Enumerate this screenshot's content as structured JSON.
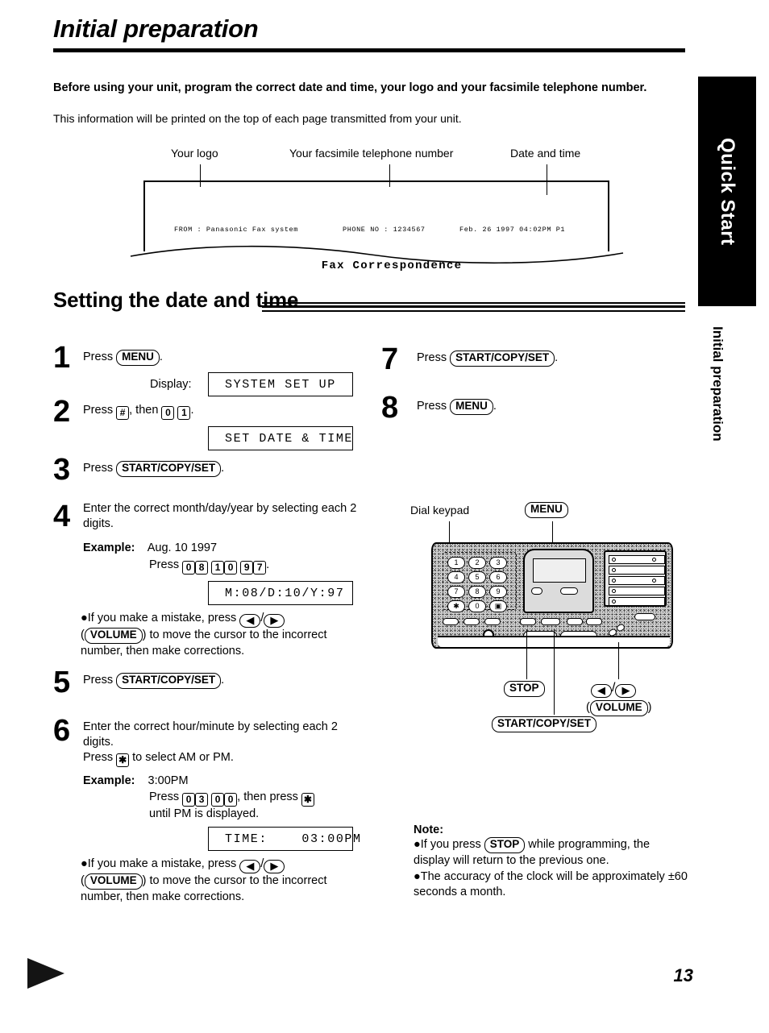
{
  "page": {
    "title": "Initial preparation",
    "number": "13"
  },
  "intro": {
    "bold": "Before using your unit, program the correct date and time, your logo and your facsimile telephone number.",
    "plain": "This information will be printed on the top of each page transmitted from your unit."
  },
  "fax_sample": {
    "callouts": {
      "logo": "Your logo",
      "phone": "Your facsimile telephone number",
      "datetime": "Date and time"
    },
    "header_from": "FROM : Panasonic Fax system",
    "header_phone": "PHONE NO : 1234567",
    "header_date": "Feb. 26 1997 04:02PM P1",
    "body_text": "Fax Correspondence"
  },
  "section": {
    "heading": "Setting the date and time"
  },
  "steps": {
    "s1": {
      "num": "1",
      "press_label": "Press",
      "key": "MENU",
      "period": ".",
      "display_label": "Display:",
      "display_value": "SYSTEM SET UP"
    },
    "s2": {
      "num": "2",
      "press_label": "Press",
      "key_hash": "#",
      "then_label": ", then",
      "key_0": "0",
      "key_1": "1",
      "period": ".",
      "display_value": "SET DATE & TIME"
    },
    "s3": {
      "num": "3",
      "press_label": "Press",
      "key": "START/COPY/SET",
      "period": "."
    },
    "s4": {
      "num": "4",
      "text": "Enter the correct month/day/year by selecting each 2 digits.",
      "example_label": "Example:",
      "example_value": "Aug. 10 1997",
      "press_label": "Press",
      "digits": [
        "0",
        "8",
        "1",
        "0",
        "9",
        "7"
      ],
      "period": ".",
      "display_value": "M:08/D:10/Y:97",
      "note_lead": "If you make a mistake, press",
      "note_arrow_left": "◀",
      "note_slash": "/",
      "note_arrow_right": "▶",
      "note_volume_open": "(",
      "note_volume": "VOLUME",
      "note_volume_close": ")",
      "note_tail": "to move the cursor to the incorrect number, then make corrections."
    },
    "s5": {
      "num": "5",
      "press_label": "Press",
      "key": "START/COPY/SET",
      "period": "."
    },
    "s6": {
      "num": "6",
      "text_line1": "Enter the correct hour/minute by selecting",
      "text_line2": "each 2 digits.",
      "press_star_pre": "Press",
      "key_star": "✱",
      "press_star_post": "to select AM or PM.",
      "example_label": "Example:",
      "example_value": "3:00PM",
      "press_label": "Press",
      "digits": [
        "0",
        "3",
        "0",
        "0"
      ],
      "then_press": ", then press",
      "until_text": "until PM is displayed.",
      "display_value": "TIME:    03:00PM",
      "note_lead": "If you make a mistake, press",
      "note_arrow_left": "◀",
      "note_slash": "/",
      "note_arrow_right": "▶",
      "note_volume_open": "(",
      "note_volume": "VOLUME",
      "note_volume_close": ")",
      "note_tail": "to move the cursor to the incorrect number, then make corrections."
    },
    "s7": {
      "num": "7",
      "press_label": "Press",
      "key": "START/COPY/SET",
      "period": "."
    },
    "s8": {
      "num": "8",
      "press_label": "Press",
      "key": "MENU",
      "period": "."
    }
  },
  "machine": {
    "label_dial_keypad": "Dial keypad",
    "label_menu": "MENU",
    "label_stop": "STOP",
    "label_start": "START/COPY/SET",
    "label_arrow_left": "◀",
    "label_arrow_slash": "/",
    "label_arrow_right": "▶",
    "label_volume_open": "(",
    "label_volume": "VOLUME",
    "label_volume_close": ")",
    "keypad_keys": [
      "1",
      "2",
      "3",
      "4",
      "5",
      "6",
      "7",
      "8",
      "9",
      "✱",
      "0",
      "▣"
    ]
  },
  "note": {
    "title": "Note:",
    "item1_pre": "If you press",
    "item1_key": "STOP",
    "item1_post": "while programming, the display will return to the previous one.",
    "item2": "The accuracy of the clock will be approximately ±60 seconds a month."
  },
  "side_tab": {
    "main": "Quick Start",
    "sub": "Initial preparation"
  }
}
